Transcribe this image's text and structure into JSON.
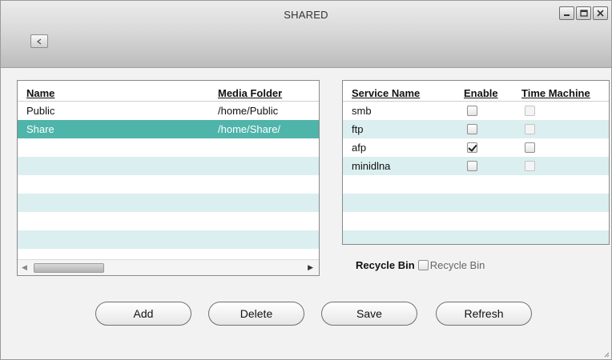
{
  "window": {
    "title": "SHARED",
    "controls": [
      "minimize-icon",
      "maximize-icon",
      "close-icon"
    ]
  },
  "toolbar": {
    "back_icon": "chevron-left-icon"
  },
  "shares_table": {
    "columns": [
      "Name",
      "Media Folder"
    ],
    "rows": [
      {
        "name": "Public",
        "folder": "/home/Public",
        "selected": false
      },
      {
        "name": "Share",
        "folder": "/home/Share/",
        "selected": true
      }
    ]
  },
  "services_table": {
    "columns": [
      "Service Name",
      "Enable",
      "Time Machine"
    ],
    "rows": [
      {
        "name": "smb",
        "enable": false,
        "time_machine": false,
        "tm_disabled": true
      },
      {
        "name": "ftp",
        "enable": false,
        "time_machine": false,
        "tm_disabled": true
      },
      {
        "name": "afp",
        "enable": true,
        "time_machine": false,
        "tm_disabled": false
      },
      {
        "name": "minidlna",
        "enable": false,
        "time_machine": false,
        "tm_disabled": true
      }
    ]
  },
  "recycle_bin": {
    "label": "Recycle Bin",
    "checkbox_label": "Recycle Bin",
    "checked": false
  },
  "buttons": {
    "add": "Add",
    "delete": "Delete",
    "save": "Save",
    "refresh": "Refresh"
  },
  "colors": {
    "selected_row": "#4fb4a9",
    "alt_row": "#dbeef0",
    "title_bar": "#d9d9d9"
  }
}
